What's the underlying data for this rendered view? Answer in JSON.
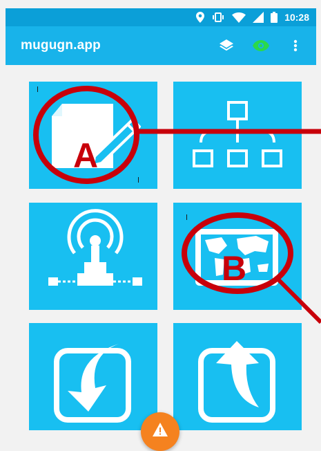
{
  "status_bar": {
    "time": "10:28",
    "icons": [
      "location-icon",
      "vibrate-icon",
      "wifi-icon",
      "signal-icon",
      "battery-icon"
    ],
    "color": "#0b9fd8"
  },
  "app_bar": {
    "title": "mugugn.app",
    "icons": [
      "layers-icon",
      "eye-icon",
      "more-vert-icon"
    ],
    "color": "#18b3ea",
    "eye_color": "#2bd94a"
  },
  "tiles": [
    {
      "name": "edit-document",
      "icon": "document-pen-icon"
    },
    {
      "name": "network-diagram",
      "icon": "network-tree-icon"
    },
    {
      "name": "broadcast",
      "icon": "antenna-icon"
    },
    {
      "name": "world-map",
      "icon": "map-icon"
    },
    {
      "name": "import",
      "icon": "download-arrow-icon"
    },
    {
      "name": "export",
      "icon": "upload-arrow-icon"
    }
  ],
  "annotations": {
    "a_label": "A",
    "b_label": "B",
    "color": "#c8000a"
  },
  "fab": {
    "icon": "warning-icon",
    "color": "#f5821f"
  }
}
